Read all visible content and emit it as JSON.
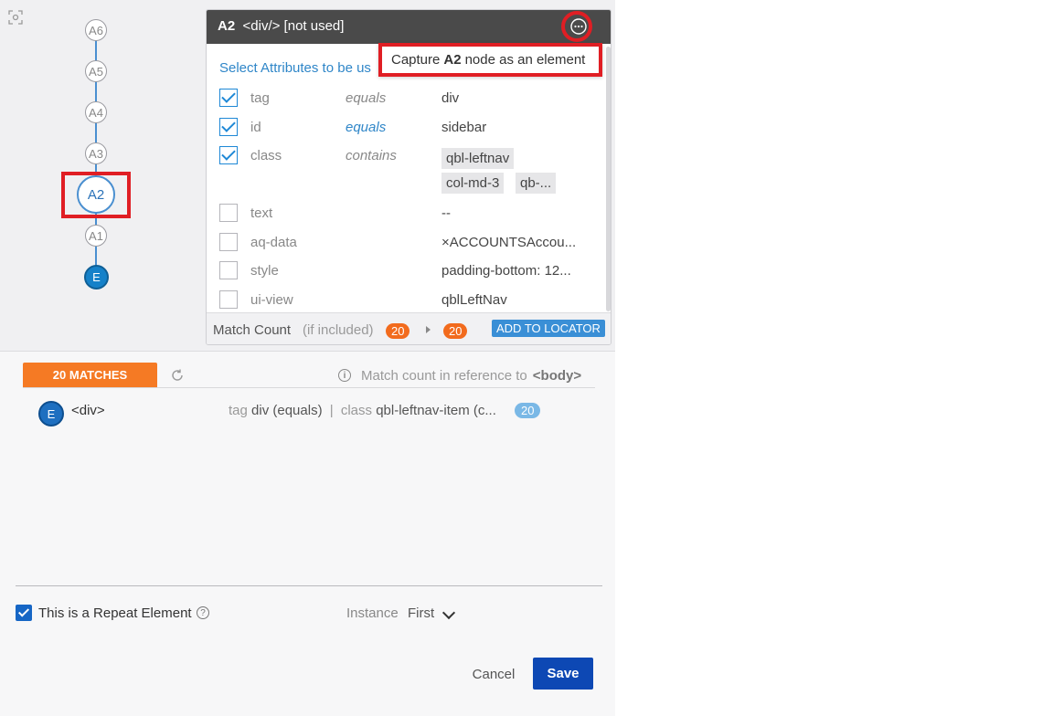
{
  "tree": {
    "nodes": [
      "A6",
      "A5",
      "A4",
      "A3",
      "A2",
      "A1",
      "E"
    ],
    "selected": "A2"
  },
  "panel": {
    "node_id": "A2",
    "node_info": "<div/> [not used]",
    "select_label": "Select Attributes to be us",
    "attributes": [
      {
        "name": "tag",
        "operator": "equals",
        "value": "div",
        "checked": true
      },
      {
        "name": "id",
        "operator": "equals",
        "value": "sidebar",
        "checked": true
      },
      {
        "name": "class",
        "operator": "contains",
        "chips": [
          "qbl-leftnav",
          "col-md-3",
          "qb-..."
        ],
        "checked": true
      },
      {
        "name": "text",
        "operator": "",
        "value": "--",
        "checked": false
      },
      {
        "name": "aq-data",
        "operator": "",
        "value": "×ACCOUNTSAccou...",
        "checked": false
      },
      {
        "name": "style",
        "operator": "",
        "value": "padding-bottom: 12...",
        "checked": false
      },
      {
        "name": "ui-view",
        "operator": "",
        "value": "qblLeftNav",
        "checked": false
      }
    ],
    "footer": {
      "match_count_label": "Match Count",
      "if_included": "(if included)",
      "count_a": "20",
      "count_b": "20",
      "add_button": "ADD TO LOCATOR"
    }
  },
  "tooltip": {
    "prefix": "Capture",
    "node": "A2",
    "suffix": "node as an element"
  },
  "matches": {
    "tab_label": "20 MATCHES",
    "reference_text": "Match count in reference to",
    "reference_tag": "<body>",
    "item": {
      "badge": "E",
      "tag": "<div>",
      "k1": "tag",
      "v1": "div (equals)",
      "sep": "|",
      "k2": "class",
      "v2": "qbl-leftnav-item (c...",
      "count": "20"
    }
  },
  "repeat": {
    "label": "This is a Repeat Element",
    "help": "?",
    "instance_label": "Instance",
    "instance_value": "First"
  },
  "actions": {
    "cancel": "Cancel",
    "save": "Save"
  },
  "colors": {
    "accent_orange": "#f26b1d",
    "primary_blue": "#0d48b4",
    "highlight_red": "#e01e24"
  }
}
